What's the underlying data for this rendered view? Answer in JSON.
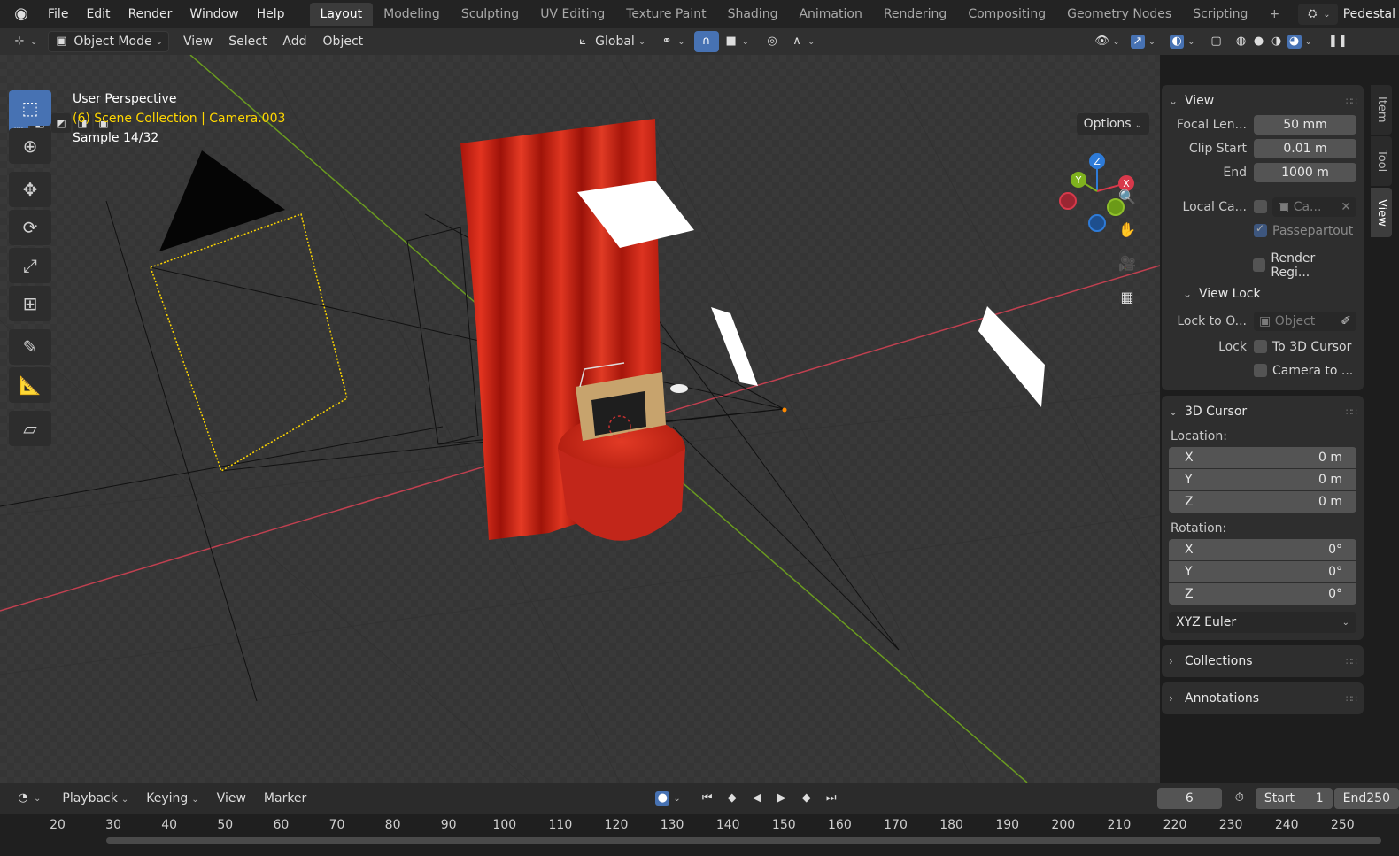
{
  "menubar": {
    "items": [
      "File",
      "Edit",
      "Render",
      "Window",
      "Help"
    ],
    "workspaces": [
      "Layout",
      "Modeling",
      "Sculpting",
      "UV Editing",
      "Texture Paint",
      "Shading",
      "Animation",
      "Rendering",
      "Compositing",
      "Geometry Nodes",
      "Scripting"
    ],
    "active_workspace": "Layout",
    "add_tab": "+",
    "scene_name": "Pedestal"
  },
  "header": {
    "mode": "Object Mode",
    "menus": [
      "View",
      "Select",
      "Add",
      "Object"
    ],
    "transform_orientation": "Global",
    "options": "Options"
  },
  "viewport": {
    "perspective": "User Perspective",
    "collection": "(6) Scene Collection | Camera.003",
    "sample": "Sample 14/32",
    "gizmo": {
      "x": "X",
      "y": "Y",
      "z": "Z"
    }
  },
  "sidepanel": {
    "view_section": {
      "title": "View",
      "focal_length_label": "Focal Len...",
      "focal_length": "50 mm",
      "clip_start_label": "Clip Start",
      "clip_start": "0.01 m",
      "end_label": "End",
      "end": "1000 m",
      "local_camera_label": "Local Ca...",
      "local_camera_value": "Ca...",
      "passepartout": "Passepartout",
      "render_region": "Render Regi..."
    },
    "view_lock": {
      "title": "View Lock",
      "lock_to_object_label": "Lock to O...",
      "lock_to_object_placeholder": "Object",
      "lock_label": "Lock",
      "to_3d_cursor": "To 3D Cursor",
      "camera_to": "Camera to ..."
    },
    "cursor": {
      "title": "3D Cursor",
      "location_label": "Location:",
      "location": [
        {
          "axis": "X",
          "value": "0 m"
        },
        {
          "axis": "Y",
          "value": "0 m"
        },
        {
          "axis": "Z",
          "value": "0 m"
        }
      ],
      "rotation_label": "Rotation:",
      "rotation": [
        {
          "axis": "X",
          "value": "0°"
        },
        {
          "axis": "Y",
          "value": "0°"
        },
        {
          "axis": "Z",
          "value": "0°"
        }
      ],
      "rotation_mode": "XYZ Euler"
    },
    "collections": "Collections",
    "annotations": "Annotations"
  },
  "right_tabs": [
    "Item",
    "Tool",
    "View"
  ],
  "timeline": {
    "menus": [
      "Playback",
      "Keying",
      "View",
      "Marker"
    ],
    "current_frame": "6",
    "start_label": "Start",
    "start": "1",
    "end_label": "End",
    "end": "250",
    "ticks": [
      "20",
      "30",
      "40",
      "50",
      "60",
      "70",
      "80",
      "90",
      "100",
      "110",
      "120",
      "130",
      "140",
      "150",
      "160",
      "170",
      "180",
      "190",
      "200",
      "210",
      "220",
      "230",
      "240",
      "250"
    ]
  },
  "colors": {
    "accent": "#4772b3",
    "x_axis": "#c04050",
    "y_axis": "#6a9a20",
    "selection": "#ffd700",
    "curtain": "#d0291a"
  }
}
